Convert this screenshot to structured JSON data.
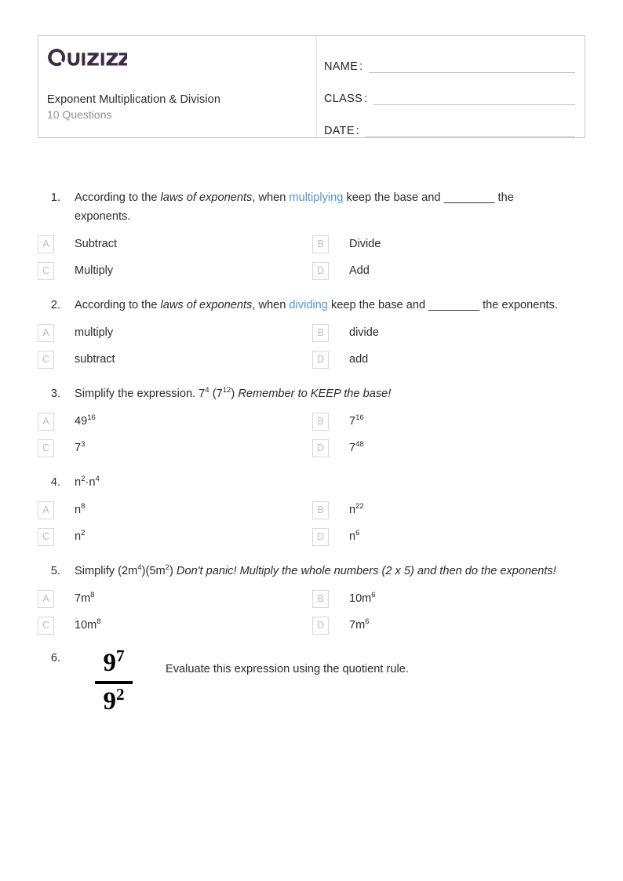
{
  "header": {
    "logo_text": "Quizizz",
    "logo_color": "#3b2b44",
    "title": "Exponent Multiplication & Division",
    "question_count": "10 Questions",
    "fields": [
      {
        "label": "NAME",
        "colon": ":",
        "value": ""
      },
      {
        "label": "CLASS",
        "colon": ":",
        "value": ""
      },
      {
        "label": "DATE",
        "colon": ":",
        "value": ""
      }
    ]
  },
  "link_color": "#5293cd",
  "questions": [
    {
      "number": "1.",
      "text_parts": [
        {
          "t": "According to the ",
          "style": "normal"
        },
        {
          "t": "laws of exponents",
          "style": "italic"
        },
        {
          "t": ", when ",
          "style": "normal"
        },
        {
          "t": "multiplying",
          "style": "link"
        },
        {
          "t": " keep the base and ________ the exponents.",
          "style": "normal"
        }
      ],
      "plain": "According to the laws of exponents, when multiplying keep the base and ________ the exponents.",
      "options": [
        {
          "letter": "A",
          "text": "Subtract"
        },
        {
          "letter": "B",
          "text": "Divide"
        },
        {
          "letter": "C",
          "text": "Multiply"
        },
        {
          "letter": "D",
          "text": "Add"
        }
      ]
    },
    {
      "number": "2.",
      "text_parts": [
        {
          "t": "According to the ",
          "style": "normal"
        },
        {
          "t": "laws of exponents",
          "style": "italic"
        },
        {
          "t": ", when ",
          "style": "normal"
        },
        {
          "t": "dividing",
          "style": "link"
        },
        {
          "t": " keep the base and ________ the exponents.",
          "style": "normal"
        }
      ],
      "plain": "According to the laws of exponents, when dividing keep the base and ________ the exponents.",
      "options": [
        {
          "letter": "A",
          "text": "multiply"
        },
        {
          "letter": "B",
          "text": "divide"
        },
        {
          "letter": "C",
          "text": "subtract"
        },
        {
          "letter": "D",
          "text": "add"
        }
      ]
    },
    {
      "number": "3.",
      "plain": "Simplify the expression. 7^4 (7^12) Remember to KEEP the base!",
      "options": [
        {
          "letter": "A",
          "base": "49",
          "exp": "16"
        },
        {
          "letter": "B",
          "base": "7",
          "exp": "16"
        },
        {
          "letter": "C",
          "base": "7",
          "exp": "3"
        },
        {
          "letter": "D",
          "base": "7",
          "exp": "48"
        }
      ]
    },
    {
      "number": "4.",
      "plain": "n^2·n^4",
      "options": [
        {
          "letter": "A",
          "base": "n",
          "exp": "8"
        },
        {
          "letter": "B",
          "base": "n",
          "exp": "22"
        },
        {
          "letter": "C",
          "base": "n",
          "exp": "2"
        },
        {
          "letter": "D",
          "base": "n",
          "exp": "6"
        }
      ]
    },
    {
      "number": "5.",
      "plain": "Simplify (2m^4)(5m^2) Don't panic! Multiply the whole numbers (2 x 5) and then do the exponents!",
      "options": [
        {
          "letter": "A",
          "base": "7m",
          "exp": "8"
        },
        {
          "letter": "B",
          "base": "10m",
          "exp": "6"
        },
        {
          "letter": "C",
          "base": "10m",
          "exp": "8"
        },
        {
          "letter": "D",
          "base": "7m",
          "exp": "6"
        }
      ]
    },
    {
      "number": "6.",
      "fraction": {
        "numerator_base": "9",
        "numerator_exp": "7",
        "denominator_base": "9",
        "denominator_exp": "2"
      },
      "prompt": "Evaluate this expression using the quotient rule."
    }
  ],
  "q3": {
    "lead": "Simplify the expression. ",
    "base1": "7",
    "exp1": "4",
    "mid": " (",
    "base2": "7",
    "exp2": "12",
    "close": ") ",
    "note": "Remember to KEEP the base!"
  },
  "q4": {
    "base1": "n",
    "exp1": "2",
    "dot": "·",
    "base2": "n",
    "exp2": "4"
  },
  "q5": {
    "lead": "Simplify (2m",
    "exp1": "4",
    "mid": ")(5m",
    "exp2": "2",
    "close": ") ",
    "note": "Don't panic! Multiply the whole numbers (2 x 5) and then do the exponents!"
  }
}
